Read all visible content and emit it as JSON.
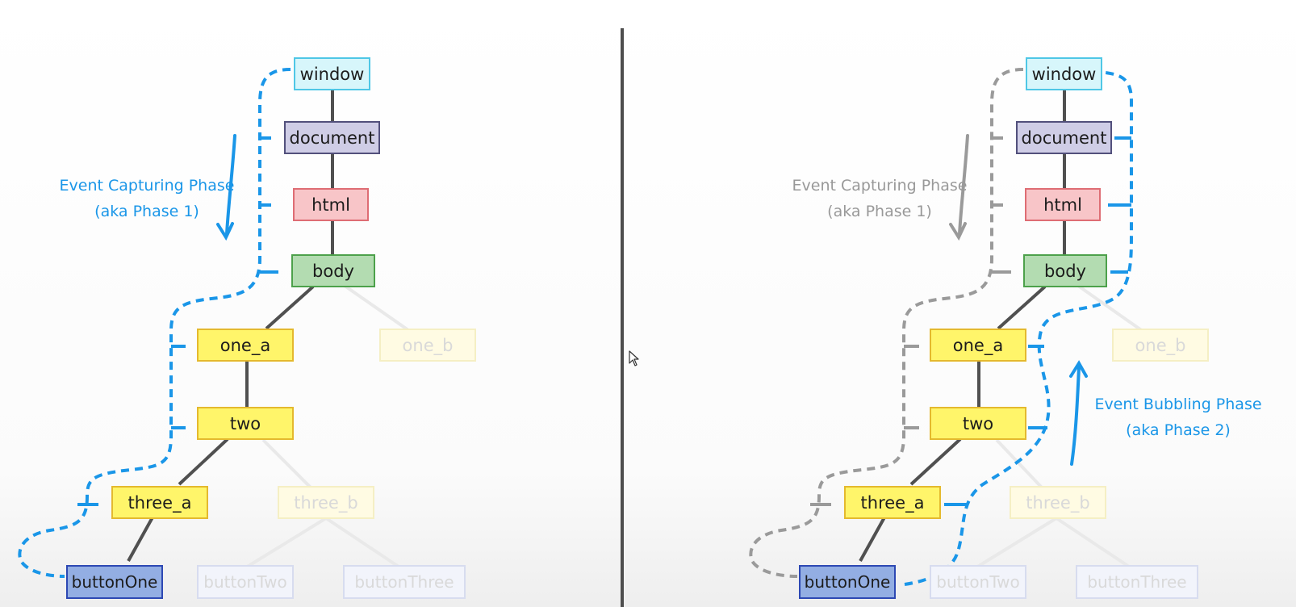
{
  "panels": {
    "left": {
      "nodes": {
        "window": "window",
        "document": "document",
        "html": "html",
        "body": "body",
        "one_a": "one_a",
        "one_b": "one_b",
        "two": "two",
        "three_a": "three_a",
        "three_b": "three_b",
        "buttonOne": "buttonOne",
        "buttonTwo": "buttonTwo",
        "buttonThree": "buttonThree"
      },
      "capturing_label": {
        "line1": "Event Capturing Phase",
        "line2": "(aka Phase 1)"
      }
    },
    "right": {
      "nodes": {
        "window": "window",
        "document": "document",
        "html": "html",
        "body": "body",
        "one_a": "one_a",
        "one_b": "one_b",
        "two": "two",
        "three_a": "three_a",
        "three_b": "three_b",
        "buttonOne": "buttonOne",
        "buttonTwo": "buttonTwo",
        "buttonThree": "buttonThree"
      },
      "capturing_label": {
        "line1": "Event Capturing Phase",
        "line2": "(aka Phase 1)"
      },
      "bubbling_label": {
        "line1": "Event Bubbling Phase",
        "line2": "(aka Phase 2)"
      }
    }
  },
  "colors": {
    "window": "#d7f6fb",
    "window_border": "#4fc7e6",
    "document": "#cfcde6",
    "document_border": "#52507c",
    "html": "#f8c5c8",
    "html_border": "#de6d74",
    "body": "#b3dcb1",
    "body_border": "#4da14b",
    "element": "#fff56a",
    "element_border": "#e4b92e",
    "button": "#93aee3",
    "button_border": "#2d48b3",
    "capture_active": "#1a96e8",
    "capture_inactive": "#9a9a9a",
    "bubble": "#1a96e8",
    "tree_line": "#505050",
    "divider": "#4e4e4e"
  }
}
